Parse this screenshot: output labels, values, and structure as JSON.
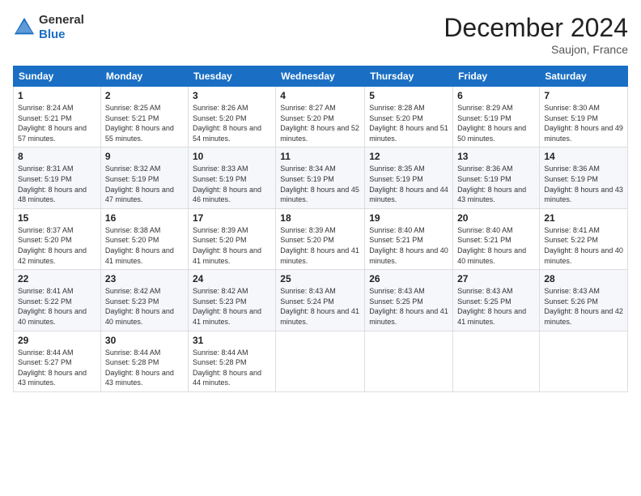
{
  "header": {
    "logo_general": "General",
    "logo_blue": "Blue",
    "month_title": "December 2024",
    "location": "Saujon, France"
  },
  "days_of_week": [
    "Sunday",
    "Monday",
    "Tuesday",
    "Wednesday",
    "Thursday",
    "Friday",
    "Saturday"
  ],
  "weeks": [
    [
      {
        "day": "1",
        "sunrise": "Sunrise: 8:24 AM",
        "sunset": "Sunset: 5:21 PM",
        "daylight": "Daylight: 8 hours and 57 minutes."
      },
      {
        "day": "2",
        "sunrise": "Sunrise: 8:25 AM",
        "sunset": "Sunset: 5:21 PM",
        "daylight": "Daylight: 8 hours and 55 minutes."
      },
      {
        "day": "3",
        "sunrise": "Sunrise: 8:26 AM",
        "sunset": "Sunset: 5:20 PM",
        "daylight": "Daylight: 8 hours and 54 minutes."
      },
      {
        "day": "4",
        "sunrise": "Sunrise: 8:27 AM",
        "sunset": "Sunset: 5:20 PM",
        "daylight": "Daylight: 8 hours and 52 minutes."
      },
      {
        "day": "5",
        "sunrise": "Sunrise: 8:28 AM",
        "sunset": "Sunset: 5:20 PM",
        "daylight": "Daylight: 8 hours and 51 minutes."
      },
      {
        "day": "6",
        "sunrise": "Sunrise: 8:29 AM",
        "sunset": "Sunset: 5:19 PM",
        "daylight": "Daylight: 8 hours and 50 minutes."
      },
      {
        "day": "7",
        "sunrise": "Sunrise: 8:30 AM",
        "sunset": "Sunset: 5:19 PM",
        "daylight": "Daylight: 8 hours and 49 minutes."
      }
    ],
    [
      {
        "day": "8",
        "sunrise": "Sunrise: 8:31 AM",
        "sunset": "Sunset: 5:19 PM",
        "daylight": "Daylight: 8 hours and 48 minutes."
      },
      {
        "day": "9",
        "sunrise": "Sunrise: 8:32 AM",
        "sunset": "Sunset: 5:19 PM",
        "daylight": "Daylight: 8 hours and 47 minutes."
      },
      {
        "day": "10",
        "sunrise": "Sunrise: 8:33 AM",
        "sunset": "Sunset: 5:19 PM",
        "daylight": "Daylight: 8 hours and 46 minutes."
      },
      {
        "day": "11",
        "sunrise": "Sunrise: 8:34 AM",
        "sunset": "Sunset: 5:19 PM",
        "daylight": "Daylight: 8 hours and 45 minutes."
      },
      {
        "day": "12",
        "sunrise": "Sunrise: 8:35 AM",
        "sunset": "Sunset: 5:19 PM",
        "daylight": "Daylight: 8 hours and 44 minutes."
      },
      {
        "day": "13",
        "sunrise": "Sunrise: 8:36 AM",
        "sunset": "Sunset: 5:19 PM",
        "daylight": "Daylight: 8 hours and 43 minutes."
      },
      {
        "day": "14",
        "sunrise": "Sunrise: 8:36 AM",
        "sunset": "Sunset: 5:19 PM",
        "daylight": "Daylight: 8 hours and 43 minutes."
      }
    ],
    [
      {
        "day": "15",
        "sunrise": "Sunrise: 8:37 AM",
        "sunset": "Sunset: 5:20 PM",
        "daylight": "Daylight: 8 hours and 42 minutes."
      },
      {
        "day": "16",
        "sunrise": "Sunrise: 8:38 AM",
        "sunset": "Sunset: 5:20 PM",
        "daylight": "Daylight: 8 hours and 41 minutes."
      },
      {
        "day": "17",
        "sunrise": "Sunrise: 8:39 AM",
        "sunset": "Sunset: 5:20 PM",
        "daylight": "Daylight: 8 hours and 41 minutes."
      },
      {
        "day": "18",
        "sunrise": "Sunrise: 8:39 AM",
        "sunset": "Sunset: 5:20 PM",
        "daylight": "Daylight: 8 hours and 41 minutes."
      },
      {
        "day": "19",
        "sunrise": "Sunrise: 8:40 AM",
        "sunset": "Sunset: 5:21 PM",
        "daylight": "Daylight: 8 hours and 40 minutes."
      },
      {
        "day": "20",
        "sunrise": "Sunrise: 8:40 AM",
        "sunset": "Sunset: 5:21 PM",
        "daylight": "Daylight: 8 hours and 40 minutes."
      },
      {
        "day": "21",
        "sunrise": "Sunrise: 8:41 AM",
        "sunset": "Sunset: 5:22 PM",
        "daylight": "Daylight: 8 hours and 40 minutes."
      }
    ],
    [
      {
        "day": "22",
        "sunrise": "Sunrise: 8:41 AM",
        "sunset": "Sunset: 5:22 PM",
        "daylight": "Daylight: 8 hours and 40 minutes."
      },
      {
        "day": "23",
        "sunrise": "Sunrise: 8:42 AM",
        "sunset": "Sunset: 5:23 PM",
        "daylight": "Daylight: 8 hours and 40 minutes."
      },
      {
        "day": "24",
        "sunrise": "Sunrise: 8:42 AM",
        "sunset": "Sunset: 5:23 PM",
        "daylight": "Daylight: 8 hours and 41 minutes."
      },
      {
        "day": "25",
        "sunrise": "Sunrise: 8:43 AM",
        "sunset": "Sunset: 5:24 PM",
        "daylight": "Daylight: 8 hours and 41 minutes."
      },
      {
        "day": "26",
        "sunrise": "Sunrise: 8:43 AM",
        "sunset": "Sunset: 5:25 PM",
        "daylight": "Daylight: 8 hours and 41 minutes."
      },
      {
        "day": "27",
        "sunrise": "Sunrise: 8:43 AM",
        "sunset": "Sunset: 5:25 PM",
        "daylight": "Daylight: 8 hours and 41 minutes."
      },
      {
        "day": "28",
        "sunrise": "Sunrise: 8:43 AM",
        "sunset": "Sunset: 5:26 PM",
        "daylight": "Daylight: 8 hours and 42 minutes."
      }
    ],
    [
      {
        "day": "29",
        "sunrise": "Sunrise: 8:44 AM",
        "sunset": "Sunset: 5:27 PM",
        "daylight": "Daylight: 8 hours and 43 minutes."
      },
      {
        "day": "30",
        "sunrise": "Sunrise: 8:44 AM",
        "sunset": "Sunset: 5:28 PM",
        "daylight": "Daylight: 8 hours and 43 minutes."
      },
      {
        "day": "31",
        "sunrise": "Sunrise: 8:44 AM",
        "sunset": "Sunset: 5:28 PM",
        "daylight": "Daylight: 8 hours and 44 minutes."
      },
      null,
      null,
      null,
      null
    ]
  ]
}
